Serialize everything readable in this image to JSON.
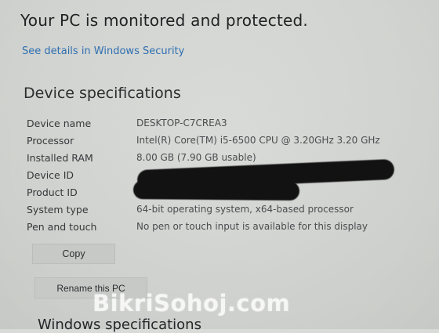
{
  "header": {
    "title": "Your PC is monitored and protected.",
    "security_link": "See details in Windows Security"
  },
  "device_specs": {
    "title": "Device specifications",
    "rows": [
      {
        "label": "Device name",
        "value": "DESKTOP-C7CREA3"
      },
      {
        "label": "Processor",
        "value": "Intel(R) Core(TM) i5-6500 CPU @ 3.20GHz   3.20 GHz"
      },
      {
        "label": "Installed RAM",
        "value": "8.00 GB (7.90 GB usable)"
      },
      {
        "label": "Device ID",
        "value": ""
      },
      {
        "label": "Product ID",
        "value": ""
      },
      {
        "label": "System type",
        "value": "64-bit operating system, x64-based processor"
      },
      {
        "label": "Pen and touch",
        "value": "No pen or touch input is available for this display"
      }
    ],
    "copy_label": "Copy",
    "rename_label": "Rename this PC"
  },
  "windows_specs": {
    "title": "Windows specifications"
  },
  "watermark": {
    "text": "BikriSohoj.com"
  }
}
